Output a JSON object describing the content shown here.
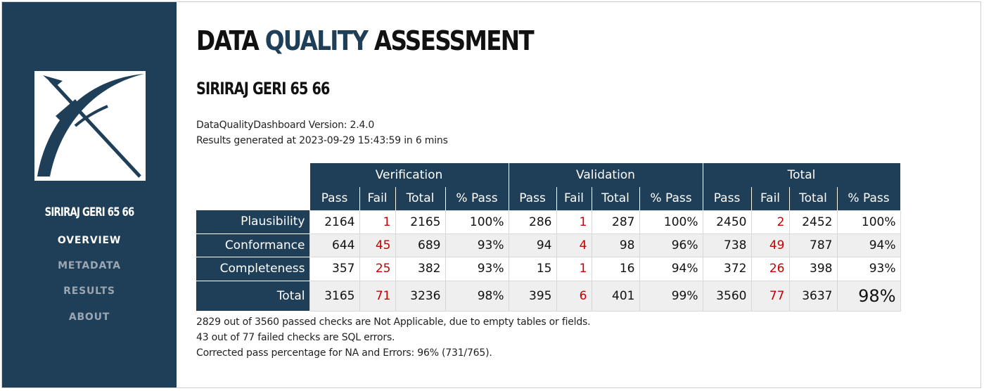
{
  "sidebar": {
    "db_name": "SIRIRAJ GERI 65 66",
    "nav": [
      {
        "label": "OVERVIEW",
        "active": true
      },
      {
        "label": "METADATA",
        "active": false
      },
      {
        "label": "RESULTS",
        "active": false
      },
      {
        "label": "ABOUT",
        "active": false
      }
    ]
  },
  "header": {
    "title_part1": "DATA ",
    "title_part2": "QUALITY",
    "title_part3": " ASSESSMENT",
    "db_name": "SIRIRAJ GERI 65 66",
    "version_line": "DataQualityDashboard Version: 2.4.0",
    "generated_line": "Results generated at 2023-09-29 15:43:59 in 6 mins"
  },
  "table": {
    "groups": [
      "Verification",
      "Validation",
      "Total"
    ],
    "subcolumns": [
      "Pass",
      "Fail",
      "Total",
      "% Pass"
    ],
    "rows": [
      {
        "label": "Plausibility",
        "values": [
          "2164",
          "1",
          "2165",
          "100%",
          "286",
          "1",
          "287",
          "100%",
          "2450",
          "2",
          "2452",
          "100%"
        ]
      },
      {
        "label": "Conformance",
        "values": [
          "644",
          "45",
          "689",
          "93%",
          "94",
          "4",
          "98",
          "96%",
          "738",
          "49",
          "787",
          "94%"
        ]
      },
      {
        "label": "Completeness",
        "values": [
          "357",
          "25",
          "382",
          "93%",
          "15",
          "1",
          "16",
          "94%",
          "372",
          "26",
          "398",
          "93%"
        ]
      },
      {
        "label": "Total",
        "values": [
          "3165",
          "71",
          "3236",
          "98%",
          "395",
          "6",
          "401",
          "99%",
          "3560",
          "77",
          "3637",
          "98%"
        ]
      }
    ]
  },
  "footnotes": [
    "2829 out of 3560 passed checks are Not Applicable, due to empty tables or fields.",
    "43 out of 77 failed checks are SQL errors.",
    "Corrected pass percentage for NA and Errors: 96% (731/765)."
  ],
  "colors": {
    "navy": "#1f3e57",
    "fail_red": "#c40000"
  }
}
